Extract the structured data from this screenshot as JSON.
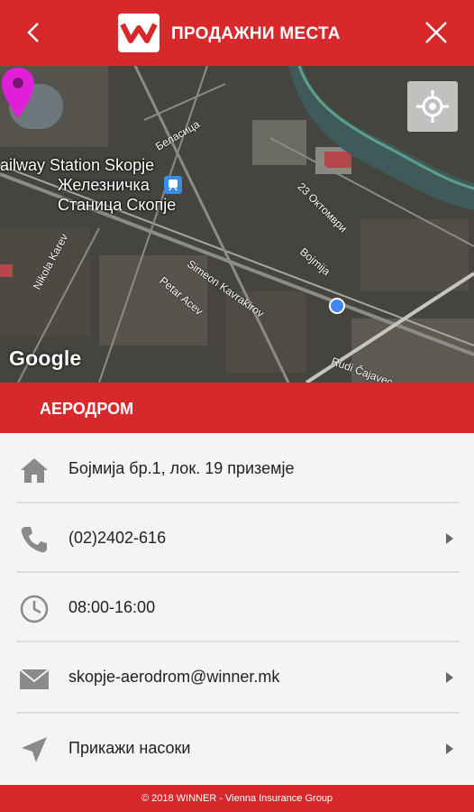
{
  "header": {
    "title": "ПРОДАЖНИ МЕСТА",
    "back_icon": "chevron-left-icon",
    "close_icon": "close-icon"
  },
  "map": {
    "labels": {
      "station_en": "ailway Station Skopje",
      "station_mk_1": "Железничка",
      "station_mk_2": "Станица Скопје"
    },
    "streets": {
      "belasica": "Беласица",
      "oktomvri": "23 Октомври",
      "bojmija": "Bojmija",
      "simeon": "Simeon Kavrakirov",
      "petar": "Petar Acev",
      "nikola": "Nikola Karev",
      "rudi": "Rudi Čajavec"
    },
    "attribution": "Google",
    "my_location_icon": "my-location-icon"
  },
  "location": {
    "name": "АЕРОДРОМ",
    "address": "Бојмија бр.1, лок. 19 приземје",
    "phone": "(02)2402-616",
    "hours": "08:00-16:00",
    "email": "skopje-aerodrom@winner.mk",
    "directions": "Прикажи насоки"
  },
  "footer": {
    "text": "© 2018 WINNER - Vienna Insurance Group"
  },
  "colors": {
    "brand_red": "#d7282c",
    "pin_magenta": "#e020d8",
    "icon_grey": "#8a8a8a"
  }
}
